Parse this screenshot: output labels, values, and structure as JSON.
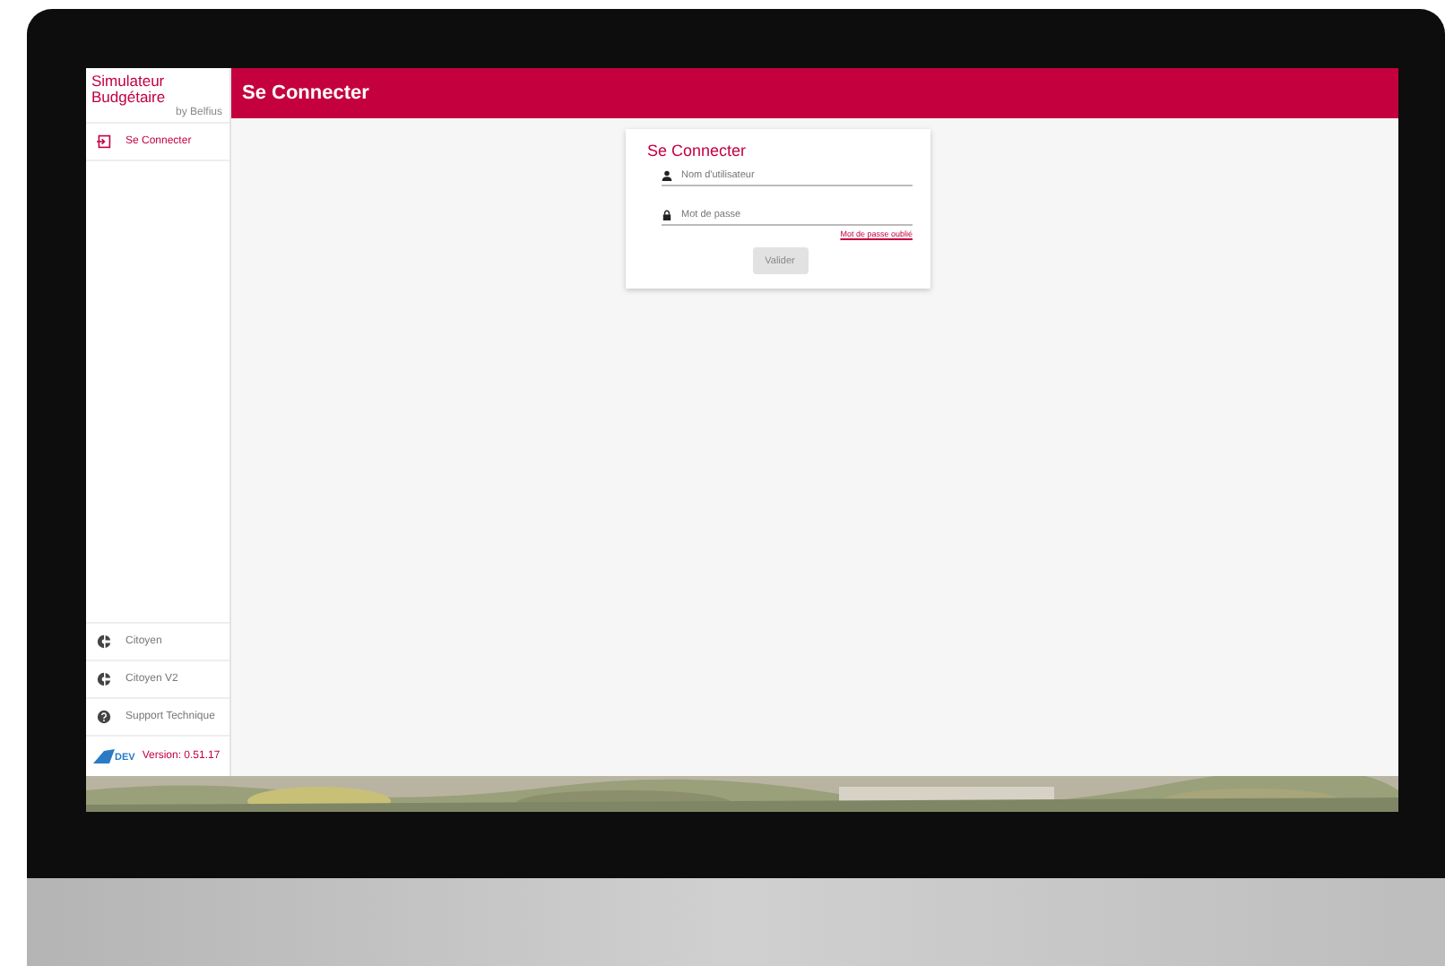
{
  "app": {
    "title_lines": [
      "Simulateur",
      "Budgétaire"
    ],
    "byline": "by Belfius"
  },
  "header": {
    "title": "Se Connecter"
  },
  "sidebar": {
    "top_items": [
      {
        "label": "Se Connecter",
        "kind": "login"
      }
    ],
    "bottom_items": [
      {
        "label": "Citoyen",
        "kind": "citizen"
      },
      {
        "label": "Citoyen V2",
        "kind": "citizen"
      },
      {
        "label": "Support Technique",
        "kind": "help"
      }
    ],
    "footer": {
      "logo": "DEV",
      "version": "Version: 0.51.17"
    }
  },
  "login": {
    "title": "Se Connecter",
    "fields": [
      {
        "kind": "user",
        "placeholder": "Nom d'utilisateur"
      },
      {
        "kind": "password",
        "placeholder": "Mot de passe"
      }
    ],
    "forgot_link": "Mot de passe oublié",
    "submit": {
      "label": "Valider",
      "disabled": true
    }
  }
}
